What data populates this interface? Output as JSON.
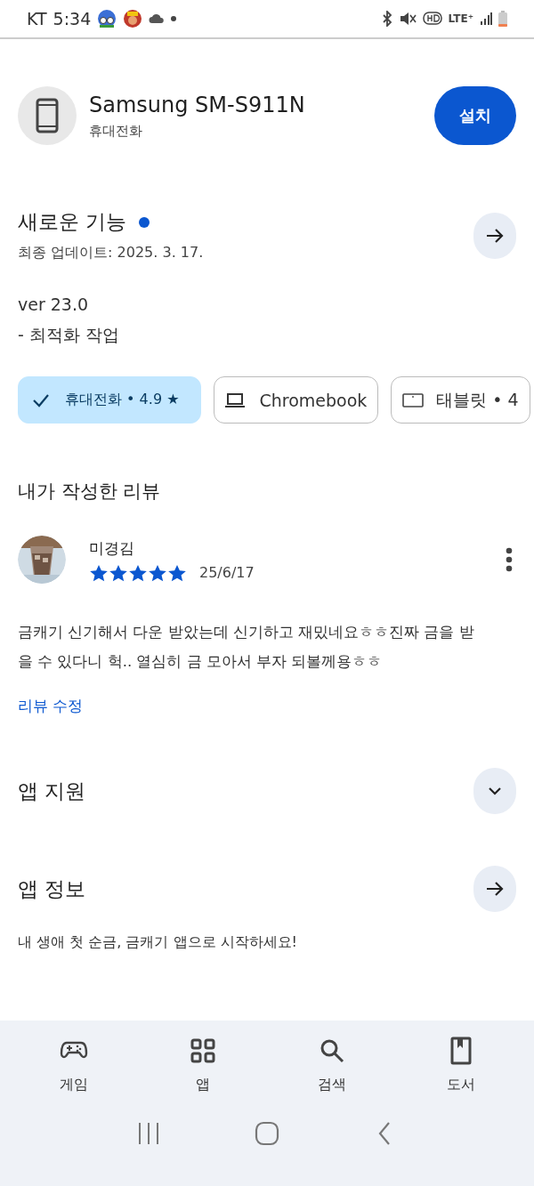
{
  "status_bar": {
    "carrier": "KT",
    "time": "5:34",
    "network": "LTE⁺"
  },
  "device": {
    "name": "Samsung SM-S911N",
    "type": "휴대전화",
    "button": "설치"
  },
  "whats_new": {
    "title": "새로운 기능",
    "unread": true,
    "updated": "최종 업데이트: 2025. 3. 17.",
    "lines": [
      "ver 23.0",
      "- 최적화 작업"
    ]
  },
  "chips": [
    {
      "kind": "phone",
      "label": "휴대전화 • 4.9 ★",
      "selected": true
    },
    {
      "kind": "laptop",
      "label": "Chromebook",
      "selected": false
    },
    {
      "kind": "tablet",
      "label": "태블릿 • 4",
      "selected": false
    }
  ],
  "my_review": {
    "heading": "내가 작성한 리뷰",
    "author": "미경김",
    "stars": 5,
    "date": "25/6/17",
    "text": "금캐기 신기해서 다운 받았는데 신기하고 재밌네요ㅎㅎ진짜 금을 받을 수 있다니 헉.. 열심히 금 모아서 부자 되볼께용ㅎㅎ",
    "edit_link": "리뷰 수정"
  },
  "sections": [
    {
      "kind": "expand",
      "title": "앱 지원",
      "expanded": false
    },
    {
      "kind": "link",
      "title": "앱 정보"
    }
  ],
  "about": "내 생애 첫 순금, 금캐기 앱으로 시작하세요!",
  "bottom_nav": [
    {
      "kind": "game",
      "label": "게임",
      "selected": false
    },
    {
      "kind": "apps",
      "label": "앱",
      "selected": false
    },
    {
      "kind": "search",
      "label": "검색",
      "selected": false
    },
    {
      "kind": "books",
      "label": "도서",
      "selected": false
    }
  ]
}
